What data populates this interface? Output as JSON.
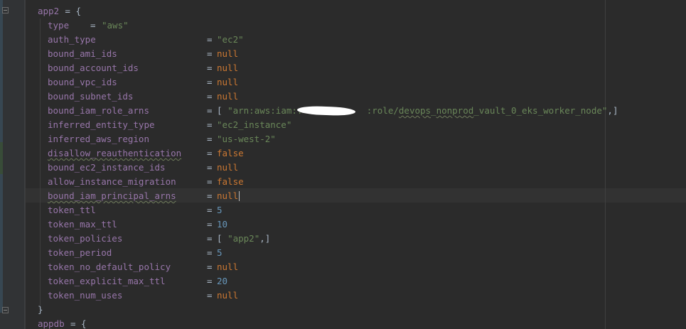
{
  "lines": [
    {
      "key": "app2",
      "op": "= {",
      "kind": "block-open"
    },
    {
      "key": "type",
      "op": "=",
      "value": [
        {
          "t": "\"aws\"",
          "c": "str"
        }
      ]
    },
    {
      "key": "auth_type",
      "op": "=",
      "value": [
        {
          "t": "\"ec2\"",
          "c": "str"
        }
      ]
    },
    {
      "key": "bound_ami_ids",
      "op": "=",
      "value": [
        {
          "t": "null",
          "c": "kw"
        }
      ]
    },
    {
      "key": "bound_account_ids",
      "op": "=",
      "value": [
        {
          "t": "null",
          "c": "kw"
        }
      ]
    },
    {
      "key": "bound_vpc_ids",
      "op": "=",
      "value": [
        {
          "t": "null",
          "c": "kw"
        }
      ]
    },
    {
      "key": "bound_subnet_ids",
      "op": "=",
      "value": [
        {
          "t": "null",
          "c": "kw"
        }
      ]
    },
    {
      "key": "bound_iam_role_arns",
      "op": "=",
      "value": [
        {
          "t": "[ ",
          "c": "plain"
        },
        {
          "t": "\"arn:aws:iam::",
          "c": "str"
        },
        {
          "t": "            ",
          "c": "str"
        },
        {
          "t": ":role/",
          "c": "str"
        },
        {
          "t": "devops",
          "c": "str typo"
        },
        {
          "t": "_",
          "c": "str"
        },
        {
          "t": "nonprod",
          "c": "str typo"
        },
        {
          "t": "_vault_0_eks_worker_node\"",
          "c": "str"
        },
        {
          "t": ",]",
          "c": "plain"
        }
      ]
    },
    {
      "key": "inferred_entity_type",
      "op": "=",
      "value": [
        {
          "t": "\"ec2_instance\"",
          "c": "str"
        }
      ]
    },
    {
      "key": "inferred_aws_region",
      "op": "=",
      "value": [
        {
          "t": "\"us-west-2\"",
          "c": "str"
        }
      ]
    },
    {
      "key": "disallow_reauthentication",
      "op": "=",
      "value": [
        {
          "t": "false",
          "c": "kw"
        }
      ]
    },
    {
      "key": "bound_ec2_instance_ids",
      "op": "=",
      "value": [
        {
          "t": "null",
          "c": "kw"
        }
      ]
    },
    {
      "key": "allow_instance_migration",
      "op": "=",
      "value": [
        {
          "t": "false",
          "c": "kw"
        }
      ]
    },
    {
      "key": "bound_iam_principal_arns",
      "op": "=",
      "value": [
        {
          "t": "null",
          "c": "kw"
        }
      ]
    },
    {
      "key": "token_ttl",
      "op": "=",
      "value": [
        {
          "t": "5",
          "c": "num"
        }
      ]
    },
    {
      "key": "token_max_ttl",
      "op": "=",
      "value": [
        {
          "t": "10",
          "c": "num"
        }
      ]
    },
    {
      "key": "token_policies",
      "op": "=",
      "value": [
        {
          "t": "[ ",
          "c": "plain"
        },
        {
          "t": "\"app2\"",
          "c": "str"
        },
        {
          "t": ",]",
          "c": "plain"
        }
      ]
    },
    {
      "key": "token_period",
      "op": "=",
      "value": [
        {
          "t": "5",
          "c": "num"
        }
      ]
    },
    {
      "key": "token_no_default_policy",
      "op": "=",
      "value": [
        {
          "t": "null",
          "c": "kw"
        }
      ]
    },
    {
      "key": "token_explicit_max_ttl",
      "op": "=",
      "value": [
        {
          "t": "20",
          "c": "num"
        }
      ]
    },
    {
      "key": "token_num_uses",
      "op": "=",
      "value": [
        {
          "t": "null",
          "c": "kw"
        }
      ]
    },
    {
      "key": "}",
      "op": "",
      "kind": "block-close"
    },
    {
      "key": "appdb",
      "op": "= {",
      "kind": "block-open"
    }
  ],
  "colors": {
    "background": "#2b2b2b",
    "gutter": "#313335",
    "property": "#9876aa",
    "string": "#6a8759",
    "number": "#6897bb",
    "keyword": "#cc7832",
    "text": "#a9b7c6",
    "change_added": "#384c38",
    "change_modified": "#374752"
  },
  "icons": {
    "fold": "fold-marker-icon",
    "redaction": "redaction-mark"
  }
}
